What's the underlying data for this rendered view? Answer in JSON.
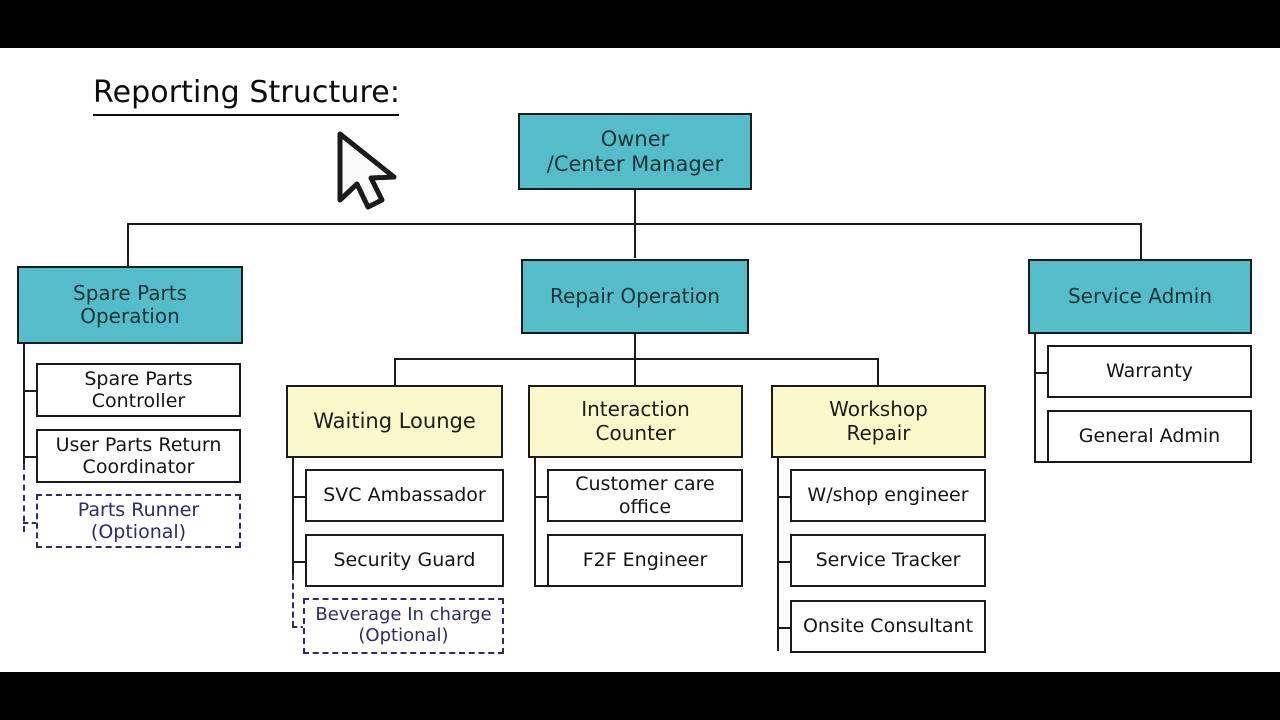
{
  "page": {
    "title": "Reporting Structure:",
    "cursor_icon": "mouse-pointer-icon"
  },
  "colors": {
    "teal": "#55bcc9",
    "yellow": "#fbf8cc",
    "white": "#ffffff",
    "line": "#1b1b1b",
    "optional_accent": "#2b2b70",
    "letterbox": "#000000"
  },
  "chart_data": {
    "type": "diagram",
    "title": "Reporting Structure:",
    "nodes": [
      {
        "id": "owner",
        "label": "Owner\n/Center Manager",
        "style": "teal",
        "level": 0
      },
      {
        "id": "spare-parts-operation",
        "label": "Spare Parts\nOperation",
        "style": "teal",
        "level": 1
      },
      {
        "id": "repair-operation",
        "label": "Repair Operation",
        "style": "teal",
        "level": 1
      },
      {
        "id": "service-admin",
        "label": "Service Admin",
        "style": "teal",
        "level": 1
      },
      {
        "id": "spare-parts-controller",
        "label": "Spare Parts\nController",
        "style": "white",
        "level": 2
      },
      {
        "id": "user-parts-return-coordinator",
        "label": "User Parts Return\nCoordinator",
        "style": "white",
        "level": 2
      },
      {
        "id": "parts-runner",
        "label": "Parts Runner\n(Optional)",
        "style": "dashed",
        "level": 2
      },
      {
        "id": "waiting-lounge",
        "label": "Waiting Lounge",
        "style": "yellow",
        "level": 2
      },
      {
        "id": "interaction-counter",
        "label": "Interaction\nCounter",
        "style": "yellow",
        "level": 2
      },
      {
        "id": "workshop-repair",
        "label": "Workshop\nRepair",
        "style": "yellow",
        "level": 2
      },
      {
        "id": "warranty",
        "label": "Warranty",
        "style": "white",
        "level": 2
      },
      {
        "id": "general-admin",
        "label": "General Admin",
        "style": "white",
        "level": 2
      },
      {
        "id": "svc-ambassador",
        "label": "SVC Ambassador",
        "style": "white",
        "level": 3
      },
      {
        "id": "security-guard",
        "label": "Security Guard",
        "style": "white",
        "level": 3
      },
      {
        "id": "beverage-in-charge",
        "label": "Beverage In charge\n(Optional)",
        "style": "dashed",
        "level": 3
      },
      {
        "id": "customer-care-office",
        "label": "Customer care office",
        "style": "white",
        "level": 3
      },
      {
        "id": "f2f-engineer",
        "label": "F2F Engineer",
        "style": "white",
        "level": 3
      },
      {
        "id": "wshop-engineer",
        "label": "W/shop engineer",
        "style": "white",
        "level": 3
      },
      {
        "id": "service-tracker",
        "label": "Service Tracker",
        "style": "white",
        "level": 3
      },
      {
        "id": "onsite-consultant",
        "label": "Onsite Consultant",
        "style": "white",
        "level": 3
      }
    ],
    "edges": [
      {
        "from": "owner",
        "to": "spare-parts-operation"
      },
      {
        "from": "owner",
        "to": "repair-operation"
      },
      {
        "from": "owner",
        "to": "service-admin"
      },
      {
        "from": "spare-parts-operation",
        "to": "spare-parts-controller"
      },
      {
        "from": "spare-parts-operation",
        "to": "user-parts-return-coordinator"
      },
      {
        "from": "spare-parts-operation",
        "to": "parts-runner",
        "style": "dashed"
      },
      {
        "from": "repair-operation",
        "to": "waiting-lounge"
      },
      {
        "from": "repair-operation",
        "to": "interaction-counter"
      },
      {
        "from": "repair-operation",
        "to": "workshop-repair"
      },
      {
        "from": "service-admin",
        "to": "warranty"
      },
      {
        "from": "service-admin",
        "to": "general-admin"
      },
      {
        "from": "waiting-lounge",
        "to": "svc-ambassador"
      },
      {
        "from": "waiting-lounge",
        "to": "security-guard"
      },
      {
        "from": "waiting-lounge",
        "to": "beverage-in-charge",
        "style": "dashed"
      },
      {
        "from": "interaction-counter",
        "to": "customer-care-office"
      },
      {
        "from": "interaction-counter",
        "to": "f2f-engineer"
      },
      {
        "from": "workshop-repair",
        "to": "wshop-engineer"
      },
      {
        "from": "workshop-repair",
        "to": "service-tracker"
      },
      {
        "from": "workshop-repair",
        "to": "onsite-consultant"
      }
    ]
  },
  "nodes": {
    "owner": {
      "line1": "Owner",
      "line2": "/Center Manager"
    },
    "spare_parts_operation": {
      "line1": "Spare Parts",
      "line2": "Operation"
    },
    "repair_operation": {
      "line1": "Repair Operation"
    },
    "service_admin": {
      "line1": "Service Admin"
    },
    "spare_parts_controller": {
      "line1": "Spare Parts",
      "line2": "Controller"
    },
    "user_parts_return_coordinator": {
      "line1": "User Parts Return",
      "line2": "Coordinator"
    },
    "parts_runner": {
      "line1": "Parts Runner",
      "line2": "(Optional)"
    },
    "waiting_lounge": {
      "line1": "Waiting Lounge"
    },
    "interaction_counter": {
      "line1": "Interaction",
      "line2": "Counter"
    },
    "workshop_repair": {
      "line1": "Workshop",
      "line2": "Repair"
    },
    "warranty": {
      "line1": "Warranty"
    },
    "general_admin": {
      "line1": "General Admin"
    },
    "svc_ambassador": {
      "line1": "SVC Ambassador"
    },
    "security_guard": {
      "line1": "Security Guard"
    },
    "beverage_in_charge": {
      "line1": "Beverage In charge",
      "line2": "(Optional)"
    },
    "customer_care_office": {
      "line1": "Customer care office"
    },
    "f2f_engineer": {
      "line1": "F2F Engineer"
    },
    "wshop_engineer": {
      "line1": "W/shop engineer"
    },
    "service_tracker": {
      "line1": "Service Tracker"
    },
    "onsite_consultant": {
      "line1": "Onsite Consultant"
    }
  }
}
